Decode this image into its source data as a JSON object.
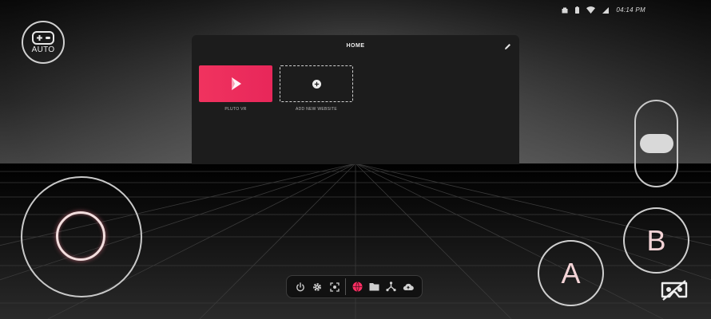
{
  "status_bar": {
    "time": "04:14 PM",
    "icons": [
      "box-icon",
      "battery-icon",
      "wifi-icon",
      "signal-icon"
    ]
  },
  "auto_button": {
    "label": "AUTO",
    "icon": "gamepad-icon"
  },
  "home_panel": {
    "title": "HOME",
    "edit_icon": "pencil-icon",
    "tiles": [
      {
        "label": "PLUTO VR",
        "icon": "play-icon",
        "color": "#f0335f"
      },
      {
        "label": "ADD NEW WEBSITE",
        "icon": "plus-circle-icon"
      }
    ]
  },
  "controls": {
    "a_label": "A",
    "b_label": "B",
    "vr_icon": "vr-headset-icon"
  },
  "dock": {
    "icons": [
      "power-icon",
      "settings-icon",
      "recenter-icon",
      "globe-icon",
      "folder-icon",
      "share-icon",
      "cloud-icon"
    ],
    "active": "globe-icon",
    "accent": "#ff2e63"
  },
  "colors": {
    "accent": "#f0335f",
    "knob_glow": "#f2dede"
  }
}
